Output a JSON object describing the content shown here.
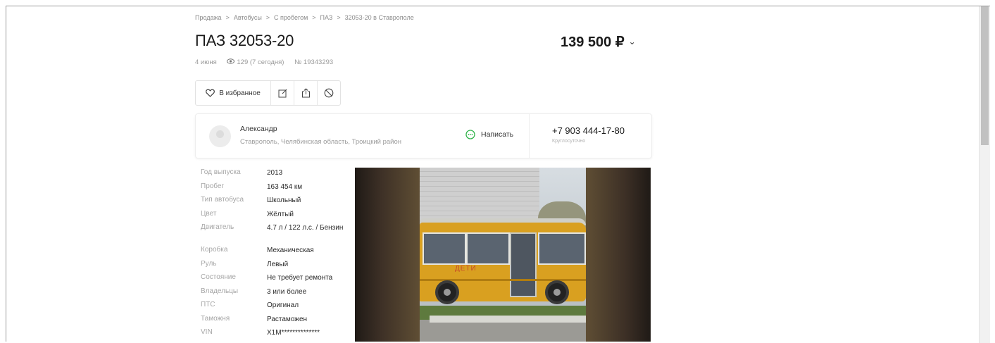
{
  "breadcrumb": [
    "Продажа",
    "Автобусы",
    "С пробегом",
    "ПАЗ",
    "32053-20 в Ставрополе"
  ],
  "listing": {
    "title": "ПАЗ 32053-20",
    "price": "139 500 ₽",
    "price_chevron": "⌄",
    "date": "4 июня",
    "views": "129 (7 сегодня)",
    "number": "№ 19343293"
  },
  "actions": {
    "favorite_label": "В избранное",
    "favorite_icon": "heart-icon",
    "note_icon": "note-icon",
    "share_icon": "share-icon",
    "block_icon": "block-icon"
  },
  "seller": {
    "name": "Александр",
    "location": "Ставрополь, Челябинская область, Троицкий район",
    "write_label": "Написать",
    "phone": "+7 903 444-17-80",
    "phone_note": "Круглосуточно"
  },
  "specs": [
    {
      "key": "Год выпуска",
      "value": "2013"
    },
    {
      "key": "Пробег",
      "value": "163 454 км"
    },
    {
      "key": "Тип автобуса",
      "value": "Школьный"
    },
    {
      "key": "Цвет",
      "value": "Жёлтый"
    },
    {
      "key": "Двигатель",
      "value": "4.7 л / 122 л.с. / Бензин"
    },
    {
      "key": "Коробка",
      "value": "Механическая"
    },
    {
      "key": "Руль",
      "value": "Левый"
    },
    {
      "key": "Состояние",
      "value": "Не требует ремонта"
    },
    {
      "key": "Владельцы",
      "value": "3 или более"
    },
    {
      "key": "ПТС",
      "value": "Оригинал"
    },
    {
      "key": "Таможня",
      "value": "Растаможен"
    },
    {
      "key": "VIN",
      "value": "X1M**************"
    }
  ],
  "photo": {
    "bus_text": "ДЕТИ"
  },
  "colors": {
    "accent_green": "#30b34a",
    "bus_yellow": "#d9a020"
  }
}
